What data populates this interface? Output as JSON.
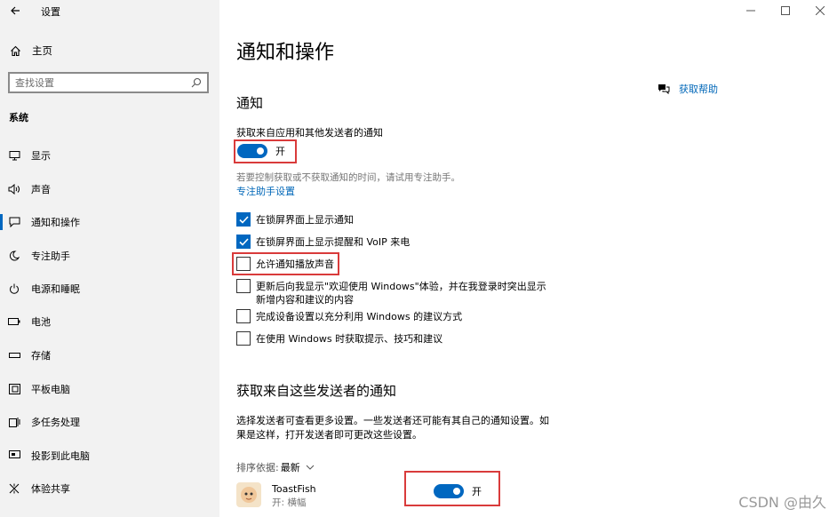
{
  "window": {
    "title": "设置"
  },
  "sidebar": {
    "home_label": "主页",
    "search_placeholder": "查找设置",
    "section_title": "系统",
    "items": [
      {
        "label": "显示",
        "icon": "monitor-icon"
      },
      {
        "label": "声音",
        "icon": "speaker-icon"
      },
      {
        "label": "通知和操作",
        "icon": "notification-icon",
        "active": true
      },
      {
        "label": "专注助手",
        "icon": "moon-icon"
      },
      {
        "label": "电源和睡眠",
        "icon": "power-icon"
      },
      {
        "label": "电池",
        "icon": "battery-icon"
      },
      {
        "label": "存储",
        "icon": "storage-icon"
      },
      {
        "label": "平板电脑",
        "icon": "tablet-icon"
      },
      {
        "label": "多任务处理",
        "icon": "multitask-icon"
      },
      {
        "label": "投影到此电脑",
        "icon": "project-icon"
      },
      {
        "label": "体验共享",
        "icon": "share-icon"
      }
    ]
  },
  "main": {
    "page_title": "通知和操作",
    "help_link": "获取帮助",
    "notifications_heading": "通知",
    "get_notifications_label": "获取来自应用和其他发送者的通知",
    "toggle_on_label": "开",
    "focus_hint": "若要控制获取或不获取通知的时间，请试用专注助手。",
    "focus_link": "专注助手设置",
    "checkboxes": [
      {
        "label": "在锁屏界面上显示通知",
        "checked": true
      },
      {
        "label": "在锁屏界面上显示提醒和 VoIP 来电",
        "checked": true
      },
      {
        "label": "允许通知播放声音",
        "checked": false
      },
      {
        "label_line1": "更新后向我显示\"欢迎使用 Windows\"体验，并在我登录时突出显示",
        "label_line2": "新增内容和建议的内容",
        "checked": false
      },
      {
        "label": "完成设备设置以充分利用 Windows 的建议方式",
        "checked": false
      },
      {
        "label": "在使用 Windows 时获取提示、技巧和建议",
        "checked": false
      }
    ],
    "senders_heading": "获取来自这些发送者的通知",
    "senders_desc_line1": "选择发送者可查看更多设置。一些发送者还可能有其自己的通知设置。如",
    "senders_desc_line2": "果是这样，打开发送者即可更改这些设置。",
    "sort_label": "排序依据:",
    "sort_value": "最新",
    "app": {
      "name": "ToastFish",
      "status": "开: 横幅",
      "toggle_label": "开"
    }
  },
  "watermark": "CSDN @由久",
  "colors": {
    "accent": "#0067c0",
    "highlight_box": "#d93b3b",
    "sidebar_bg": "#f2f2f2"
  }
}
